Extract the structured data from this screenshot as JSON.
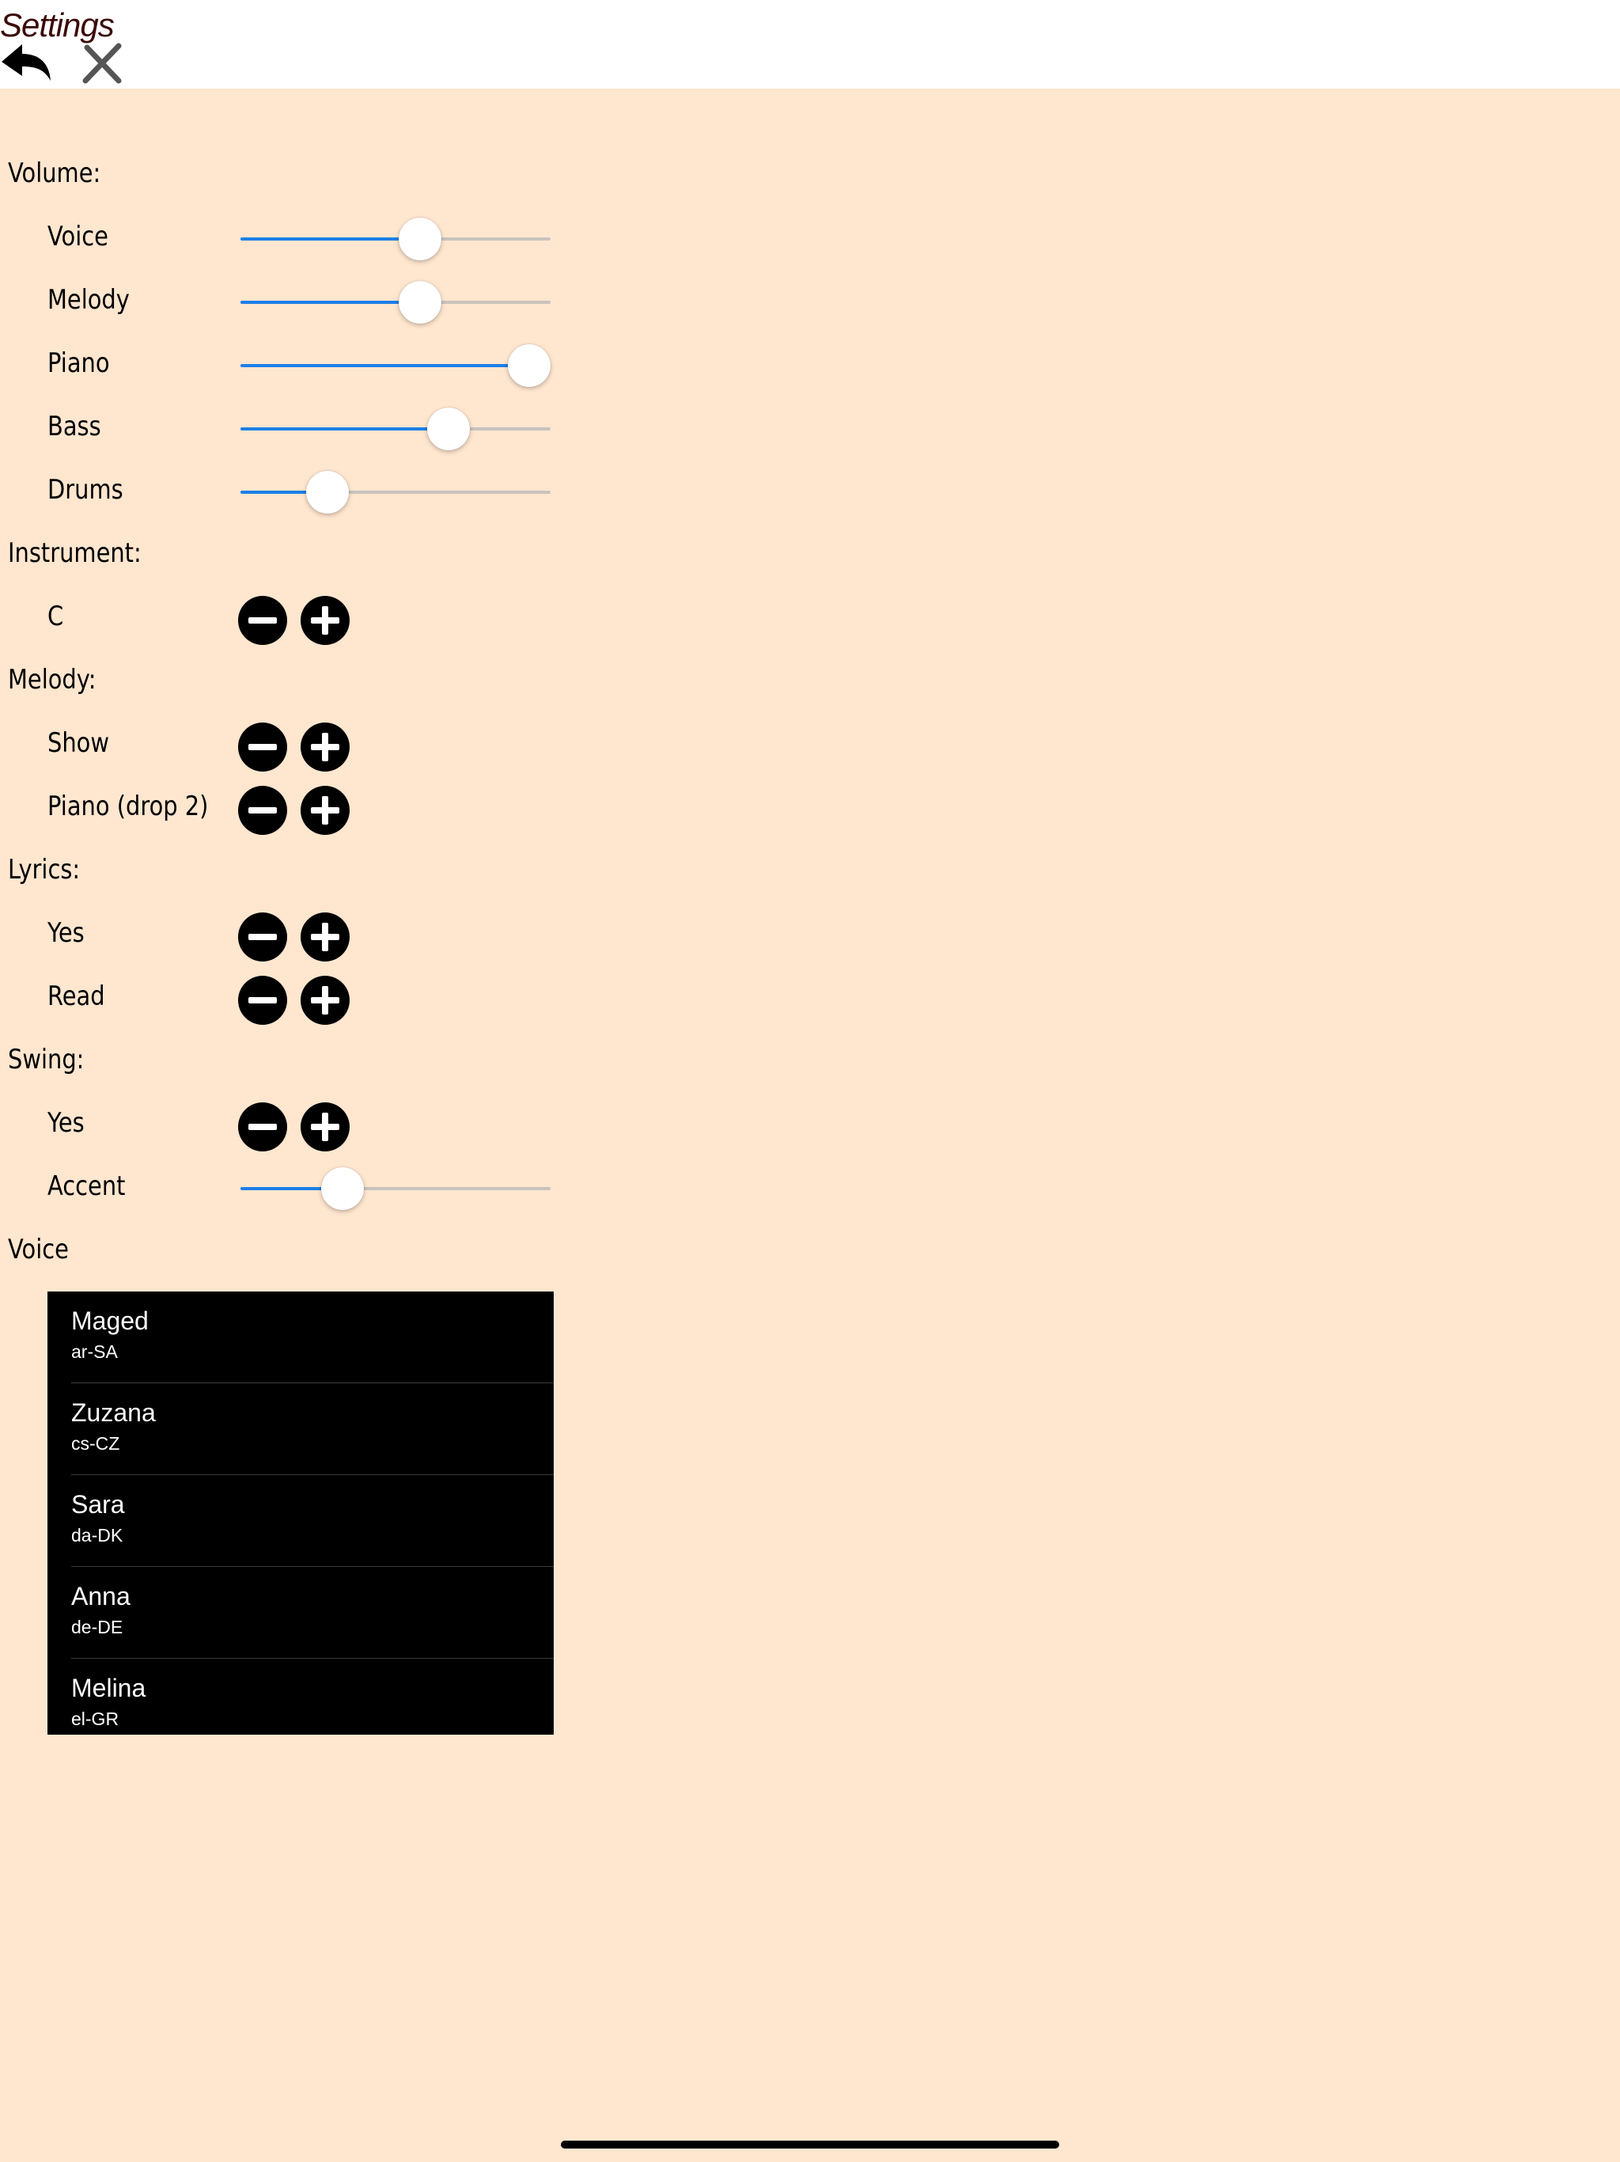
{
  "header": {
    "title": "Settings",
    "back_icon": "undo-arrow-icon",
    "close_icon": "close-x-icon"
  },
  "sections": {
    "volume": "Volume:",
    "instrument": "Instrument:",
    "melody": "Melody:",
    "lyrics": "Lyrics:",
    "swing": "Swing:",
    "voice": "Voice"
  },
  "volume": {
    "voice": {
      "label": "Voice",
      "value": 0.58
    },
    "melody": {
      "label": "Melody",
      "value": 0.58
    },
    "piano": {
      "label": "Piano",
      "value": 0.93
    },
    "bass": {
      "label": "Bass",
      "value": 0.67
    },
    "drums": {
      "label": "Drums",
      "value": 0.28
    }
  },
  "instrument": {
    "label": "C"
  },
  "melody": {
    "show": {
      "label": "Show"
    },
    "piano": {
      "label": "Piano (drop 2)"
    }
  },
  "lyrics": {
    "yes": {
      "label": "Yes"
    },
    "read": {
      "label": "Read"
    }
  },
  "swing": {
    "yes": {
      "label": "Yes"
    },
    "accent": {
      "label": "Accent",
      "value": 0.33
    }
  },
  "voices": [
    {
      "name": "Maged",
      "locale": "ar-SA"
    },
    {
      "name": "Zuzana",
      "locale": "cs-CZ"
    },
    {
      "name": "Sara",
      "locale": "da-DK"
    },
    {
      "name": "Anna",
      "locale": "de-DE"
    },
    {
      "name": "Melina",
      "locale": "el-GR"
    }
  ],
  "colors": {
    "background": "#ffe6cf",
    "slider_fill": "#1b7fe8",
    "slider_track": "#c9c3bd",
    "title": "#3a0a08"
  }
}
